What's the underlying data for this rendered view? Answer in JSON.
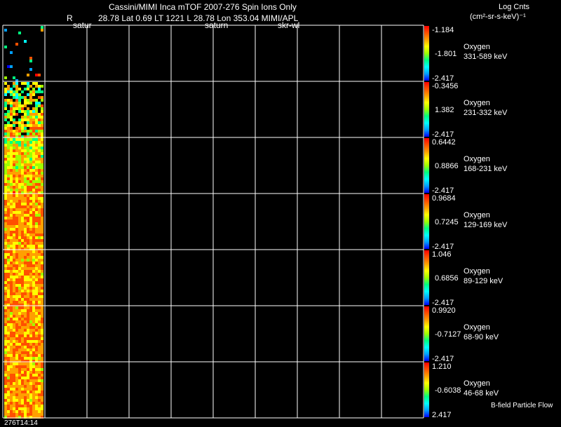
{
  "header": {
    "title": "Cassini/MIMI Inca mTOF  2007-276   Spin    Ions Only",
    "r_label": "R",
    "position_line": "28.78 Lat 0.69 LT 1221 L       28.78 Lon        353.04  MIMI/APL",
    "tag_satur": "satur",
    "tag_saturn": "saturn",
    "tag_skr": "skr-wl"
  },
  "colorbar_title": {
    "line1": "Log Cnts",
    "line2": "(cm²-sr-s-keV)⁻¹"
  },
  "footer": {
    "time_label": "276T14:14",
    "bfield_label": "B-field Particle Flow"
  },
  "chart_data": {
    "type": "heatmap",
    "grid_columns": 9,
    "panels": [
      {
        "species": "Oxygen",
        "energy": "331-589 keV",
        "scale_max": "-1.184",
        "scale_mid": "-1.801",
        "scale_min": "-2.417"
      },
      {
        "species": "Oxygen",
        "energy": "231-332 keV",
        "scale_max": "-0.3456",
        "scale_mid": "1.382",
        "scale_min": "-2.417"
      },
      {
        "species": "Oxygen",
        "energy": "168-231 keV",
        "scale_max": "0.6442",
        "scale_mid": "0.8866",
        "scale_min": "-2.417"
      },
      {
        "species": "Oxygen",
        "energy": "129-169 keV",
        "scale_max": "0.9684",
        "scale_mid": "0.7245",
        "scale_min": "-2.417"
      },
      {
        "species": "Oxygen",
        "energy": "89-129 keV",
        "scale_max": "1.046",
        "scale_mid": "0.6856",
        "scale_min": "-2.417"
      },
      {
        "species": "Oxygen",
        "energy": "68-90 keV",
        "scale_max": "0.9920",
        "scale_mid": "-0.7127",
        "scale_min": "-2.417"
      },
      {
        "species": "Oxygen",
        "energy": "46-68 keV",
        "scale_max": "1.210",
        "scale_mid": "-0.6038",
        "scale_min": "2.417"
      }
    ],
    "colormap": [
      "#0000ff",
      "#00a0ff",
      "#00ffff",
      "#00ff80",
      "#a0ff00",
      "#ffff00",
      "#ffa000",
      "#ff5000",
      "#ff0000"
    ]
  }
}
